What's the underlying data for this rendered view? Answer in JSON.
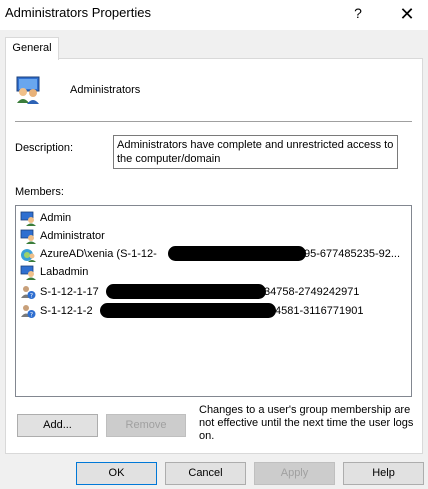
{
  "window": {
    "title": "Administrators Properties",
    "help": "?",
    "close": "✕"
  },
  "tabs": [
    {
      "label": "General"
    }
  ],
  "group": {
    "name": "Administrators"
  },
  "description": {
    "label": "Description:",
    "value": "Administrators have complete and unrestricted access to the computer/domain"
  },
  "members": {
    "label": "Members:",
    "items": [
      {
        "text": "Admin",
        "icon": "user-icon"
      },
      {
        "text": "Administrator",
        "icon": "user-icon"
      },
      {
        "text": "AzureAD\\xenia (S-1-12-",
        "suffix": "95-677485235-92...",
        "icon": "azure-user-icon"
      },
      {
        "text": "Labadmin",
        "icon": "user-icon"
      },
      {
        "text": "S-1-12-1-17",
        "suffix": "34758-2749242971",
        "icon": "unknown-sid-icon"
      },
      {
        "text": "S-1-12-1-2",
        "suffix": "4581-3116771901",
        "icon": "unknown-sid-icon"
      }
    ]
  },
  "buttons": {
    "add": "Add...",
    "remove": "Remove",
    "ok": "OK",
    "cancel": "Cancel",
    "apply": "Apply",
    "help": "Help"
  },
  "note": "Changes to a user's group membership are not effective until the next time the user logs on.",
  "colors": {
    "accent": "#0078d7",
    "disabled_text": "#a0a0a0"
  }
}
